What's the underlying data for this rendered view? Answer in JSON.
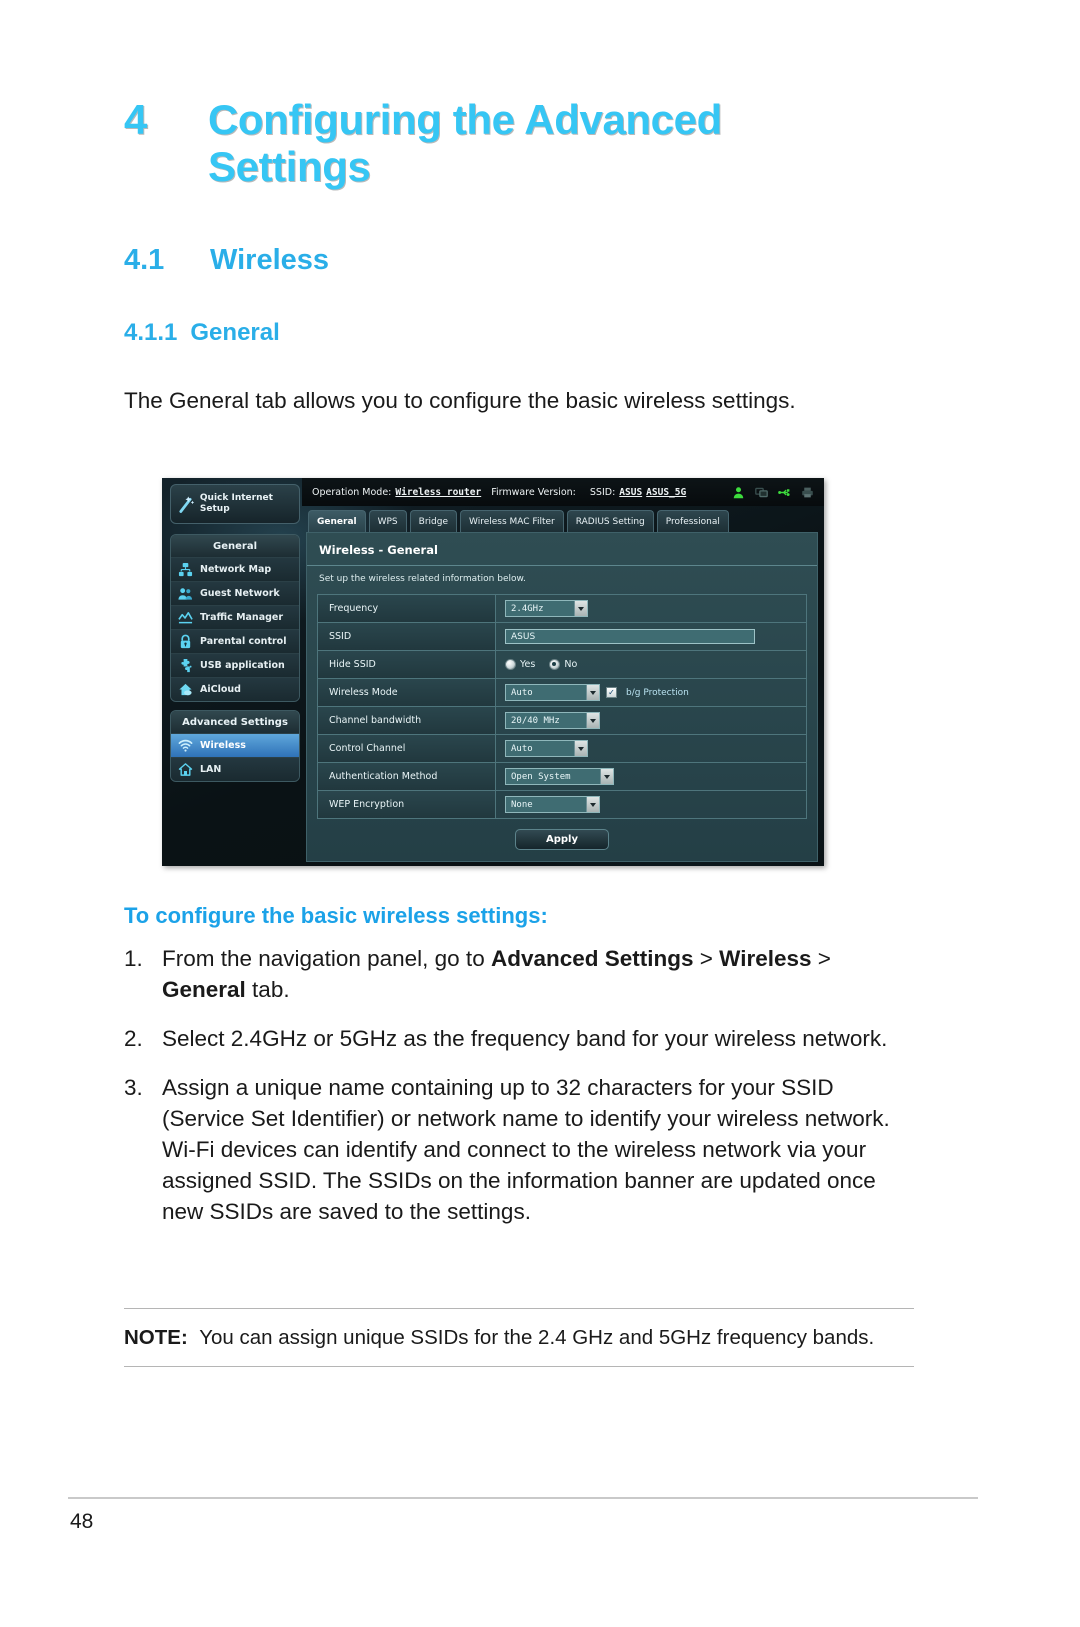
{
  "chapter": {
    "number": "4",
    "title": "Configuring the Advanced Settings"
  },
  "section": {
    "number": "4.1",
    "title": "Wireless"
  },
  "subsection": {
    "number": "4.1.1",
    "title": "General"
  },
  "intro_paragraph": "The General tab allows you to configure the basic wireless settings.",
  "router_ui": {
    "topbar": {
      "operation_mode_label": "Operation Mode:",
      "operation_mode_value": "Wireless router",
      "firmware_label": "Firmware Version:",
      "firmware_value": "",
      "ssid_label": "SSID:",
      "ssid_value_1": "ASUS",
      "ssid_value_2": "ASUS_5G",
      "icons": [
        "user-icon",
        "devices-icon",
        "usb-icon",
        "printer-icon"
      ]
    },
    "nav": {
      "quick_setup": "Quick Internet Setup",
      "general_group_title": "General",
      "general_items": [
        {
          "label": "Network Map",
          "icon": "network-map-icon"
        },
        {
          "label": "Guest Network",
          "icon": "guest-network-icon"
        },
        {
          "label": "Traffic Manager",
          "icon": "traffic-manager-icon"
        },
        {
          "label": "Parental control",
          "icon": "lock-icon"
        },
        {
          "label": "USB application",
          "icon": "usb-application-icon"
        },
        {
          "label": "AiCloud",
          "icon": "aicloud-icon"
        }
      ],
      "advanced_group_title": "Advanced Settings",
      "advanced_items": [
        {
          "label": "Wireless",
          "icon": "wifi-icon",
          "active": true
        },
        {
          "label": "LAN",
          "icon": "lan-home-icon",
          "active": false
        }
      ]
    },
    "tabs": [
      {
        "label": "General",
        "active": true
      },
      {
        "label": "WPS",
        "active": false
      },
      {
        "label": "Bridge",
        "active": false
      },
      {
        "label": "Wireless MAC Filter",
        "active": false
      },
      {
        "label": "RADIUS Setting",
        "active": false
      },
      {
        "label": "Professional",
        "active": false
      }
    ],
    "panel": {
      "title": "Wireless - General",
      "subtitle": "Set up the wireless related information below.",
      "fields": [
        {
          "key": "Frequency",
          "type": "select",
          "value": "2.4GHz"
        },
        {
          "key": "SSID",
          "type": "text",
          "value": "ASUS"
        },
        {
          "key": "Hide SSID",
          "type": "radio",
          "options": [
            "Yes",
            "No"
          ],
          "selected": "No"
        },
        {
          "key": "Wireless Mode",
          "type": "select-check",
          "value": "Auto",
          "checkbox_label": "b/g Protection",
          "checkbox_checked": true
        },
        {
          "key": "Channel bandwidth",
          "type": "select",
          "value": "20/40 MHz"
        },
        {
          "key": "Control Channel",
          "type": "select",
          "value": "Auto"
        },
        {
          "key": "Authentication Method",
          "type": "select",
          "value": "Open System"
        },
        {
          "key": "WEP Encryption",
          "type": "select",
          "value": "None"
        }
      ],
      "apply_label": "Apply"
    }
  },
  "procedure": {
    "heading": "To configure the basic wireless settings:",
    "items": [
      {
        "number": "1.",
        "parts": [
          {
            "text": "From the navigation panel, go to ",
            "bold": false
          },
          {
            "text": "Advanced Settings",
            "bold": true
          },
          {
            "text": " > ",
            "bold": false
          },
          {
            "text": "Wireless",
            "bold": true
          },
          {
            "text": " > ",
            "bold": false
          },
          {
            "text": "General",
            "bold": true
          },
          {
            "text": " tab.",
            "bold": false
          }
        ]
      },
      {
        "number": "2.",
        "parts": [
          {
            "text": "Select 2.4GHz or 5GHz as the frequency band for your wireless network.",
            "bold": false
          }
        ]
      },
      {
        "number": "3.",
        "parts": [
          {
            "text": "Assign a unique name containing up to 32 characters for your SSID (Service Set Identifier) or network name to identify your wireless network. Wi-Fi devices can identify and connect to the wireless network via your assigned SSID. The SSIDs on the information banner are updated once new SSIDs are saved to the settings.",
            "bold": false
          }
        ]
      }
    ]
  },
  "note": {
    "label": "NOTE",
    "separator": ":",
    "text": "You can assign unique SSIDs for the 2.4 GHz and 5GHz frequency bands."
  },
  "footer": {
    "page_number": "48"
  },
  "colors": {
    "heading_blue": "#36c6f4",
    "section_blue": "#2aaee8",
    "procedure_blue": "#1ba2e8",
    "body_text": "#1a1a1a"
  }
}
